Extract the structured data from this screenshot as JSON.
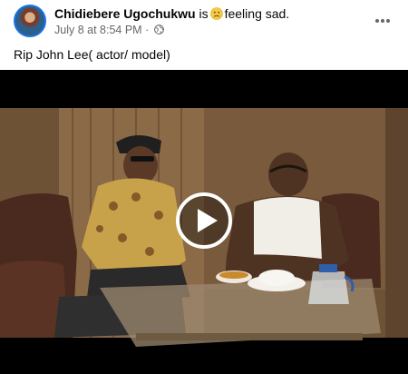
{
  "post": {
    "author_name": "Chidiebere Ugochukwu",
    "activity_prefix": "is",
    "feeling_emoji": "sad-face-emoji",
    "activity_suffix": "feeling sad.",
    "timestamp": "July 8 at 8:54 PM",
    "meta_separator": "·",
    "audience_icon": "globe-icon",
    "more_icon": "more-horizontal-icon",
    "text": "Rip John Lee( actor/ model)"
  },
  "video": {
    "play_icon": "play-icon",
    "colors": {
      "letterbox": "#000000",
      "wall": "#6e5236",
      "curtain": "#8b6a48",
      "sofa": "#4a2a1f",
      "table_glass": "#9c8a70"
    }
  },
  "colors": {
    "accent": "#1b74e4",
    "secondary_text": "#65676b",
    "primary_text": "#050505"
  }
}
